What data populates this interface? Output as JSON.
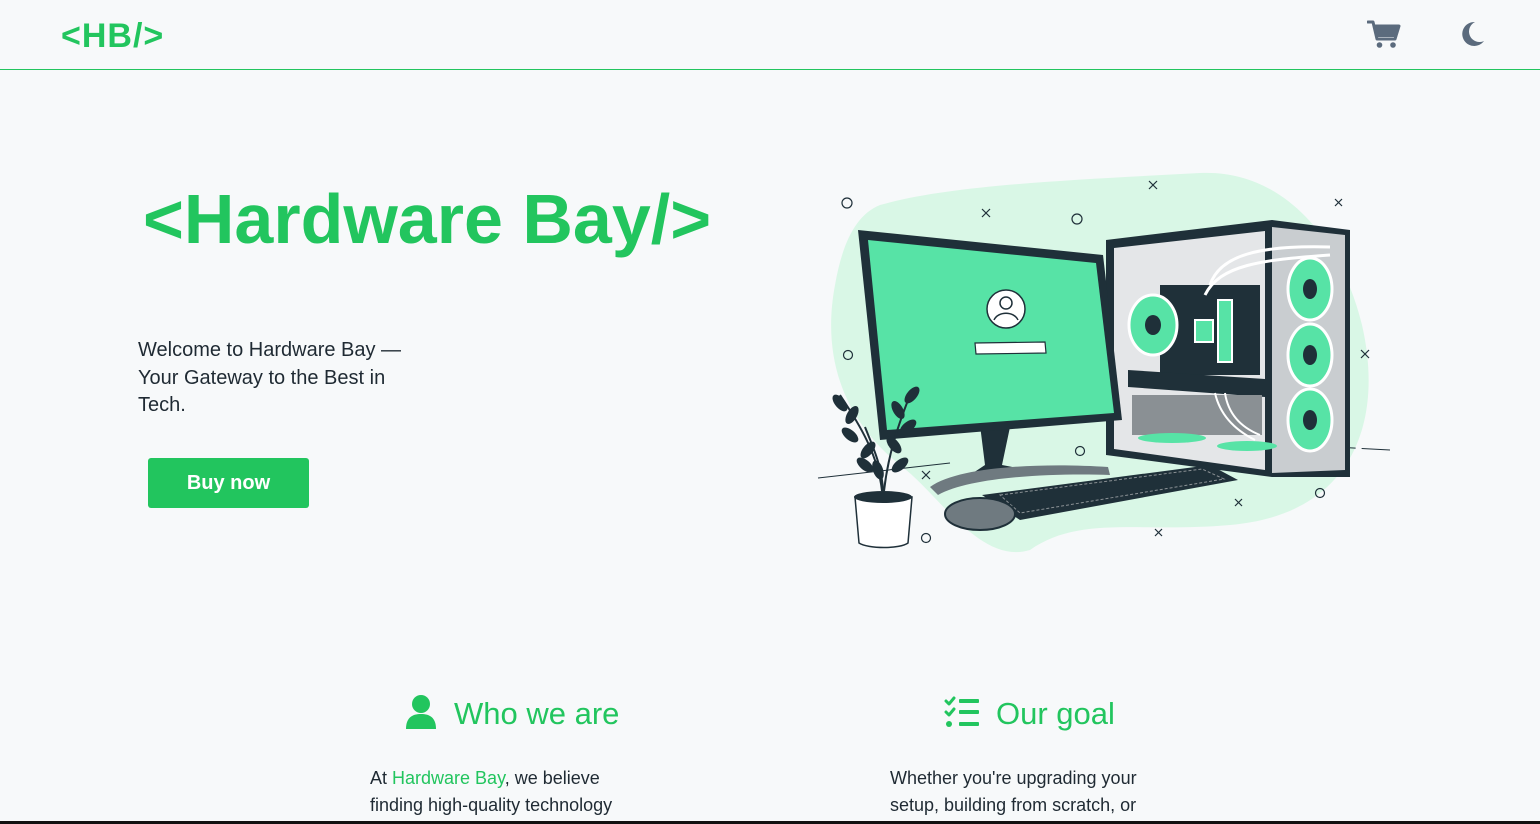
{
  "navbar": {
    "logo": "<HB/>",
    "cart_icon": "shopping-cart-icon",
    "theme_icon": "moon-icon"
  },
  "hero": {
    "title": "<Hardware Bay/>",
    "subtitle": "Welcome to Hardware Bay — Your Gateway to the Best in Tech.",
    "button_label": "Buy now",
    "illustration_login_screen": "computer-setup-illustration"
  },
  "sections": {
    "who": {
      "icon": "user-icon",
      "title": "Who we are",
      "text_prefix": "At ",
      "text_highlight": "Hardware Bay",
      "text_rest": ", we believe finding high-quality technology"
    },
    "goal": {
      "icon": "list-check-icon",
      "title": "Our goal",
      "text": "Whether you're upgrading your setup, building from scratch, or"
    }
  },
  "colors": {
    "accent": "#22c55e",
    "mint": "#57e3a6",
    "blob": "#d9f7e6",
    "dark": "#1f3039",
    "icon_gray": "#5b6b7d"
  }
}
